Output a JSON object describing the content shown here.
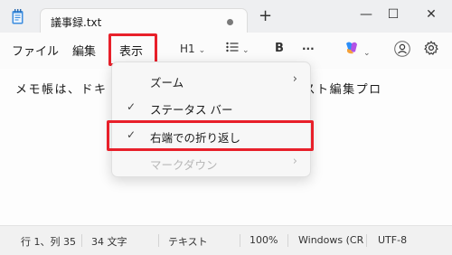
{
  "tab": {
    "title": "議事録.txt",
    "new_tab": "+"
  },
  "window": {
    "minimize": "—",
    "maximize": "☐",
    "close": "✕"
  },
  "menubar": {
    "file": "ファイル",
    "edit": "編集",
    "view": "表示",
    "heading": "H1",
    "list_icon": "list-icon",
    "bold": "B",
    "more": "···",
    "copilot_icon": "copilot-icon",
    "account_icon": "account-icon",
    "settings_icon": "gear-icon"
  },
  "document": {
    "text": "メモ帳は、ドキ　　　　　　　　　　　的なテキスト編集プロ"
  },
  "dropdown": {
    "items": [
      {
        "label": "ズーム",
        "checked": false,
        "submenu": true,
        "disabled": false
      },
      {
        "label": "ステータス バー",
        "checked": true,
        "submenu": false,
        "disabled": false
      },
      {
        "label": "右端での折り返し",
        "checked": true,
        "submenu": false,
        "disabled": false,
        "highlighted": true
      },
      {
        "label": "マークダウン",
        "checked": false,
        "submenu": true,
        "disabled": true
      }
    ],
    "check_glyph": "✓",
    "arrow_glyph": "›"
  },
  "status": {
    "position": "行 1、列 35",
    "chars": "34 文字",
    "format": "テキスト",
    "zoom": "100%",
    "line_ending": "Windows (CR",
    "encoding": "UTF-8"
  },
  "colors": {
    "highlight": "#e8202a",
    "accent": "#7b61ff"
  }
}
